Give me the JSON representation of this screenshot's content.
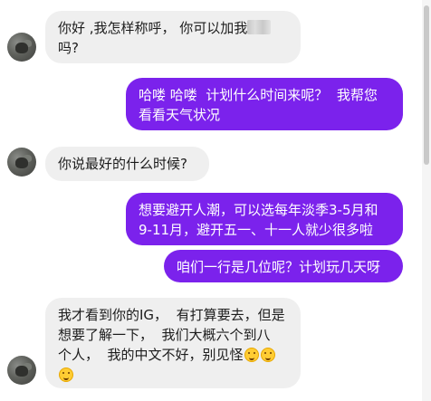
{
  "conversation": {
    "messages": [
      {
        "direction": "incoming",
        "text_before": "你好 ,我怎样称呼， 你可以加我",
        "text_after": "\n吗?"
      },
      {
        "direction": "outgoing",
        "text": "哈喽 哈喽  计划什么时间来呢？  我帮您\n看看天气状况"
      },
      {
        "direction": "incoming",
        "text": "你说最好的什么时候?"
      },
      {
        "direction": "outgoing",
        "text": "想要避开人潮，可以选每年淡季3-5月和\n9-11月，避开五一、十一人就少很多啦"
      },
      {
        "direction": "outgoing",
        "text": "咱们一行是几位呢？计划玩几天呀"
      },
      {
        "direction": "incoming",
        "text": "我才看到你的IG，  有打算要去，但是\n想要了解一下，  我们大概六个到八\n个人，  我的中文不好，别见怪"
      }
    ],
    "emojis": [
      "smiling-face-emoji",
      "smiling-face-emoji",
      "smiling-face-emoji"
    ]
  },
  "colors": {
    "incoming_bubble": "#efefef",
    "outgoing_bubble": "#7b22ec",
    "incoming_text": "#1c1c1c",
    "outgoing_text": "#ffffff"
  }
}
